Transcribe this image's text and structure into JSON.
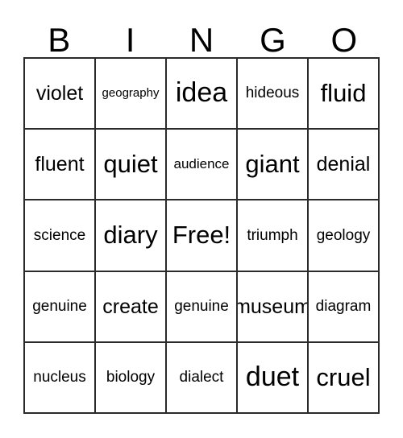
{
  "card": {
    "title": "BINGO",
    "free_space_label": "Free!",
    "grid_line_color": "#2b2b2b",
    "background_color": "#ffffff",
    "text_color": "#000000",
    "columns": 5,
    "rows": 5
  },
  "header": {
    "letters": [
      "B",
      "I",
      "N",
      "G",
      "O"
    ]
  },
  "grid": {
    "rows": [
      {
        "cells": [
          {
            "text": "violet"
          },
          {
            "text": "geography"
          },
          {
            "text": "idea"
          },
          {
            "text": "hideous"
          },
          {
            "text": "fluid"
          }
        ]
      },
      {
        "cells": [
          {
            "text": "fluent"
          },
          {
            "text": "quiet"
          },
          {
            "text": "audience"
          },
          {
            "text": "giant"
          },
          {
            "text": "denial"
          }
        ]
      },
      {
        "cells": [
          {
            "text": "science"
          },
          {
            "text": "diary"
          },
          {
            "text": "Free!"
          },
          {
            "text": "triumph"
          },
          {
            "text": "geology"
          }
        ]
      },
      {
        "cells": [
          {
            "text": "genuine"
          },
          {
            "text": "create"
          },
          {
            "text": "genuine"
          },
          {
            "text": "museum"
          },
          {
            "text": "diagram"
          }
        ]
      },
      {
        "cells": [
          {
            "text": "nucleus"
          },
          {
            "text": "biology"
          },
          {
            "text": "dialect"
          },
          {
            "text": "duet"
          },
          {
            "text": "cruel"
          }
        ]
      }
    ]
  }
}
